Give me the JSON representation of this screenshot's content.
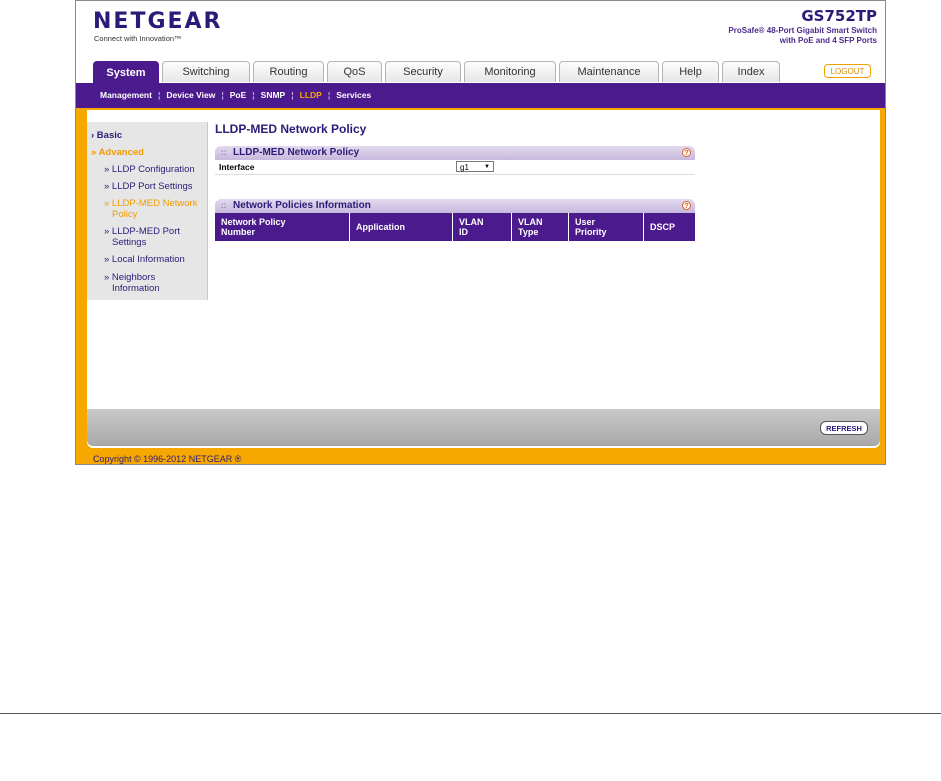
{
  "header": {
    "logo": "NETGEAR",
    "tagline": "Connect with Innovation™",
    "model": "GS752TP",
    "model_desc_line1": "ProSafe® 48-Port Gigabit Smart Switch",
    "model_desc_line2": "with PoE and 4 SFP Ports"
  },
  "tabs": [
    {
      "label": "System"
    },
    {
      "label": "Switching"
    },
    {
      "label": "Routing"
    },
    {
      "label": "QoS"
    },
    {
      "label": "Security"
    },
    {
      "label": "Monitoring"
    },
    {
      "label": "Maintenance"
    },
    {
      "label": "Help"
    },
    {
      "label": "Index"
    }
  ],
  "logout_label": "LOGOUT",
  "subnav": {
    "items": [
      {
        "label": "Management"
      },
      {
        "label": "Device View"
      },
      {
        "label": "PoE"
      },
      {
        "label": "SNMP"
      },
      {
        "label": "LLDP"
      },
      {
        "label": "Services"
      }
    ],
    "active": "LLDP"
  },
  "leftnav": {
    "basic": "› Basic",
    "advanced": "» Advanced",
    "items": [
      {
        "label": "» LLDP Configuration"
      },
      {
        "label": "» LLDP Port Settings"
      },
      {
        "label": "» LLDP-MED Network",
        "label2": "Policy"
      },
      {
        "label": "» LLDP-MED Port",
        "label2": "Settings"
      },
      {
        "label": "» Local Information"
      },
      {
        "label": "» Neighbors",
        "label2": "Information"
      }
    ]
  },
  "main": {
    "page_title": "LLDP-MED Network Policy",
    "panel1": {
      "title": "LLDP-MED Network Policy",
      "interface_label": "Interface",
      "interface_value": "g1"
    },
    "panel2": {
      "title": "Network Policies Information",
      "columns": [
        {
          "l1": "Network Policy",
          "l2": "Number"
        },
        {
          "l1": "Application",
          "l2": ""
        },
        {
          "l1": "VLAN",
          "l2": "ID"
        },
        {
          "l1": "VLAN",
          "l2": "Type"
        },
        {
          "l1": "User",
          "l2": "Priority"
        },
        {
          "l1": "DSCP",
          "l2": ""
        }
      ]
    },
    "help_glyph": "?"
  },
  "refresh_label": "REFRESH",
  "copyright": "Copyright © 1996-2012 NETGEAR ®",
  "colors": {
    "brand_purple": "#4b1a8c",
    "brand_orange": "#f7a800"
  }
}
